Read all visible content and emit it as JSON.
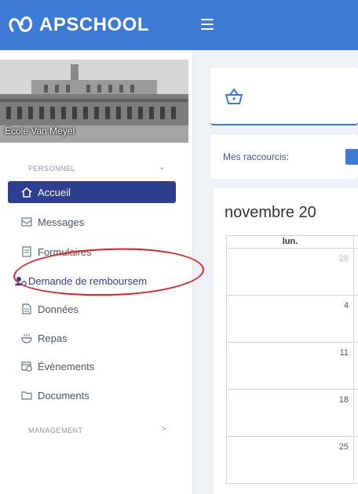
{
  "app": {
    "name": "APSCHOOL"
  },
  "sidebar": {
    "school_name": "Ecole Van Meyel",
    "sections": [
      {
        "label": "PERSONNEL"
      },
      {
        "label": "MANAGEMENT"
      }
    ],
    "items": [
      {
        "label": "Accueil",
        "icon": "home-icon",
        "active": true
      },
      {
        "label": "Messages",
        "icon": "envelope-icon"
      },
      {
        "label": "Formulaires",
        "icon": "form-icon"
      },
      {
        "label": "Demande de remboursem",
        "icon": "user-refund-icon"
      },
      {
        "label": "Données",
        "icon": "file-icon"
      },
      {
        "label": "Repas",
        "icon": "meal-icon"
      },
      {
        "label": "Évènements",
        "icon": "calendar-clock-icon"
      },
      {
        "label": "Documents",
        "icon": "folder-icon"
      }
    ]
  },
  "main": {
    "shortcuts_label": "Mes raccourcis:",
    "calendar": {
      "title": "novembre 20",
      "weekday": "lun.",
      "days": [
        {
          "day": "28",
          "other_month": true
        },
        {
          "day": "4"
        },
        {
          "day": "11"
        },
        {
          "day": "18"
        },
        {
          "day": "25"
        }
      ]
    }
  },
  "colors": {
    "header": "#3d7ad6",
    "active_item": "#2e3f8f",
    "annotation": "#e02020"
  }
}
